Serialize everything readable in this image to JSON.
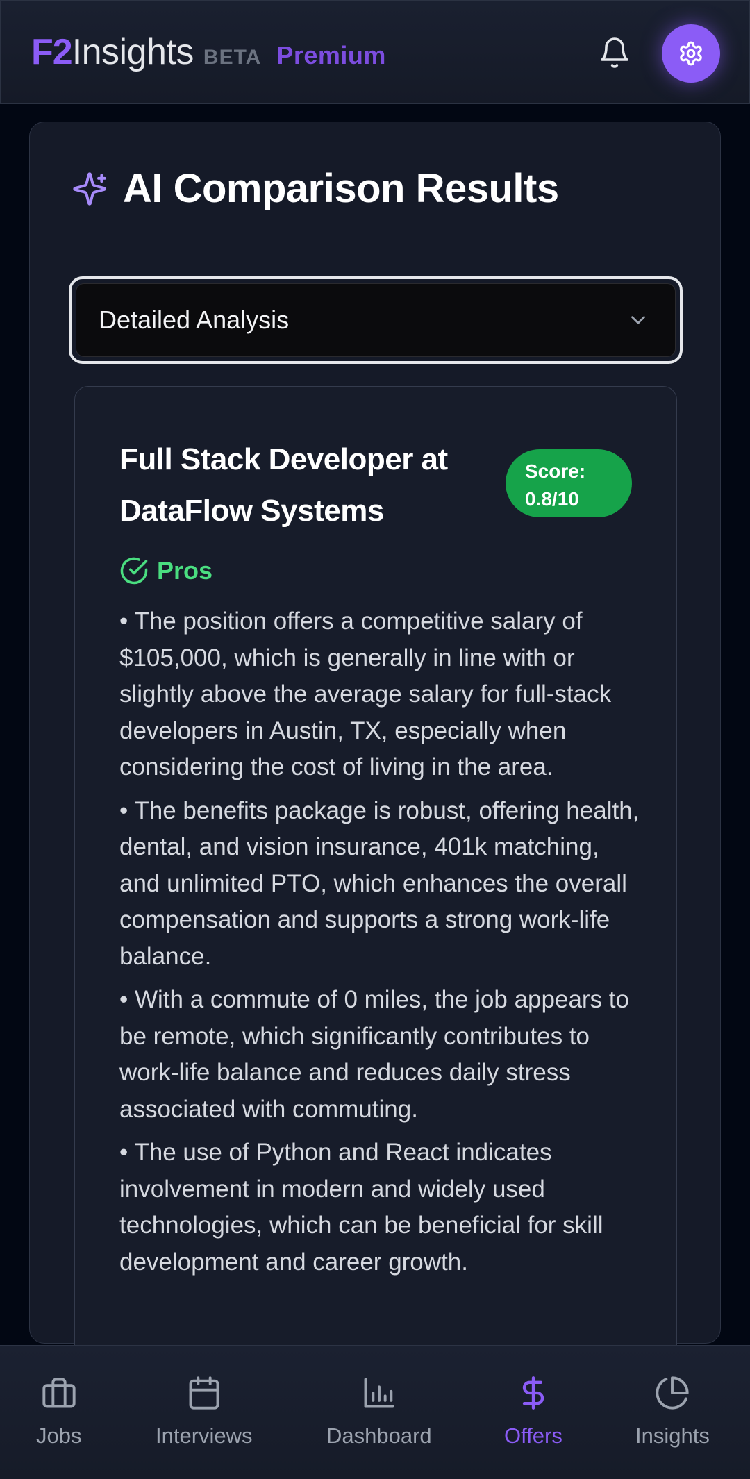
{
  "header": {
    "brand_prefix": "F2",
    "brand_name": "Insights",
    "beta_label": "BETA",
    "premium_label": "Premium"
  },
  "card": {
    "title": "AI Comparison Results",
    "select": {
      "value": "Detailed Analysis"
    },
    "offer": {
      "title": "Full Stack Developer at DataFlow Systems",
      "score_label": "Score:",
      "score_value": "0.8/10",
      "pros_heading": "Pros",
      "pros": [
        "• The position offers a competitive salary of $105,000, which is generally in line with or slightly above the average salary for full-stack developers in Austin, TX, especially when considering the cost of living in the area.",
        "• The benefits package is robust, offering health, dental, and vision insurance, 401k matching, and unlimited PTO, which enhances the overall compensation and supports a strong work-life balance.",
        "• With a commute of 0 miles, the job appears to be remote, which significantly contributes to work-life balance and reduces daily stress associated with commuting.",
        "• The use of Python and React indicates involvement in modern and widely used technologies, which can be beneficial for skill development and career growth."
      ]
    }
  },
  "nav": {
    "items": [
      {
        "label": "Jobs",
        "icon": "briefcase-icon"
      },
      {
        "label": "Interviews",
        "icon": "calendar-icon"
      },
      {
        "label": "Dashboard",
        "icon": "bar-chart-icon"
      },
      {
        "label": "Offers",
        "icon": "dollar-icon",
        "active": true
      },
      {
        "label": "Insights",
        "icon": "pie-chart-icon"
      }
    ]
  },
  "colors": {
    "accent": "#8b5cf6",
    "score_green": "#16a34a",
    "pros_green": "#4ade80",
    "background": "#020713"
  }
}
